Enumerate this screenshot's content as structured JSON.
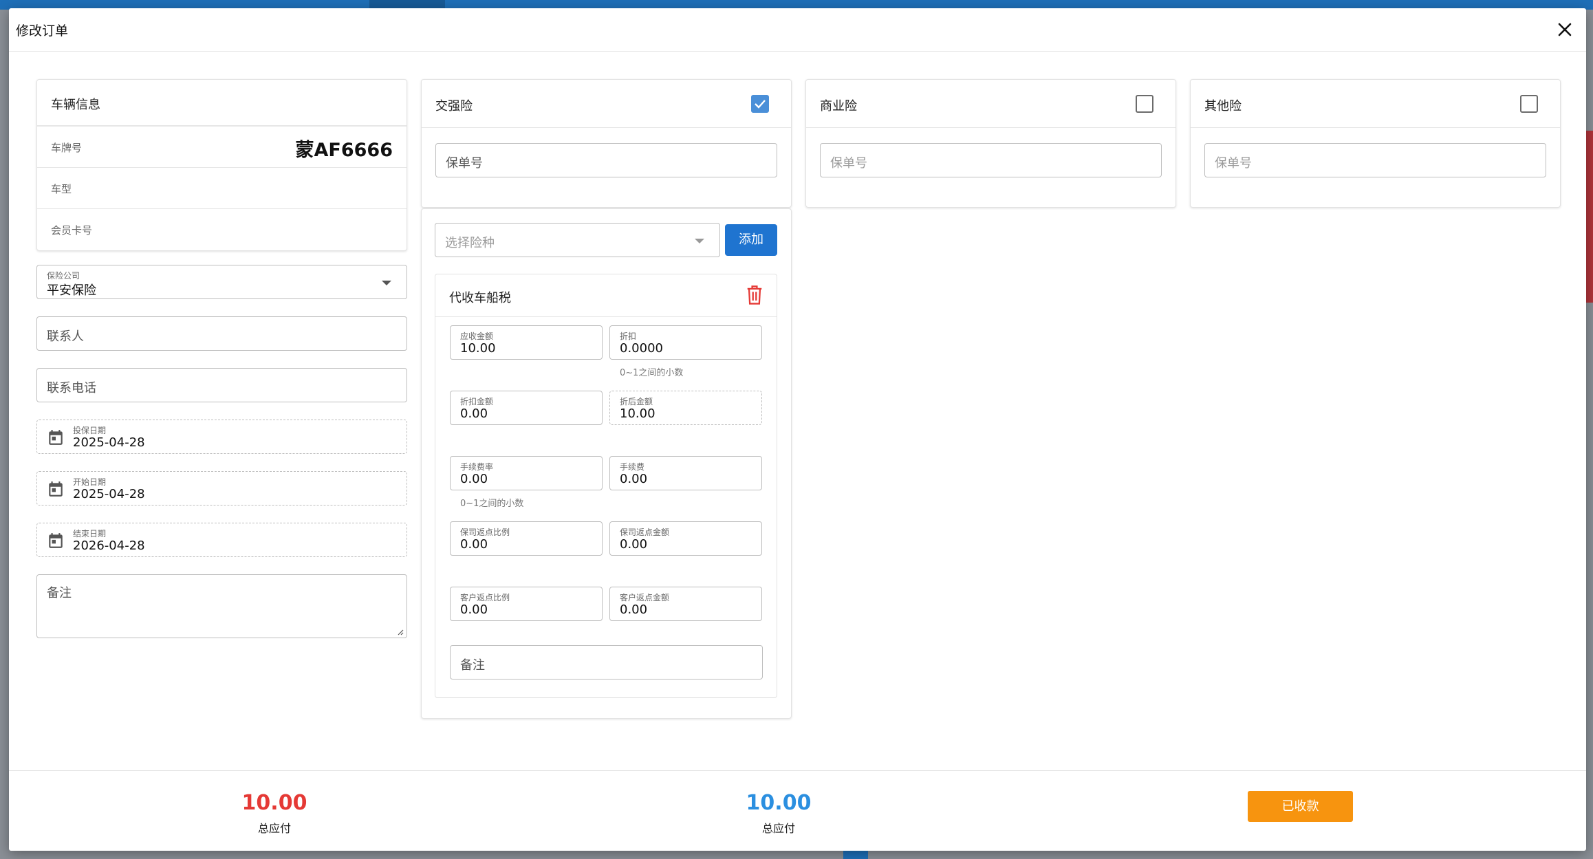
{
  "dialog": {
    "title": "修改订单"
  },
  "vehicle": {
    "header": "车辆信息",
    "plate_label": "车牌号",
    "plate_value": "蒙AF6666",
    "model_label": "车型",
    "member_label": "会员卡号"
  },
  "form": {
    "company_label": "保险公司",
    "company_value": "平安保险",
    "contact_placeholder": "联系人",
    "phone_placeholder": "联系电话",
    "insure_date_label": "投保日期",
    "insure_date_value": "2025-04-28",
    "start_date_label": "开始日期",
    "start_date_value": "2025-04-28",
    "end_date_label": "结束日期",
    "end_date_value": "2026-04-28",
    "remark_placeholder": "备注"
  },
  "compulsory": {
    "header": "交强险",
    "checked": true,
    "policy_placeholder": "保单号",
    "select_placeholder": "选择险种",
    "add_label": "添加",
    "item": {
      "title": "代收车船税",
      "receivable_label": "应收金额",
      "receivable_value": "10.00",
      "discount_label": "折扣",
      "discount_value": "0.0000",
      "discount_hint": "0~1之间的小数",
      "discount_amount_label": "折扣金额",
      "discount_amount_value": "0.00",
      "after_discount_label": "折后金额",
      "after_discount_value": "10.00",
      "fee_rate_label": "手续费率",
      "fee_rate_value": "0.00",
      "fee_rate_hint": "0~1之间的小数",
      "fee_label": "手续费",
      "fee_value": "0.00",
      "company_rebate_ratio_label": "保司返点比例",
      "company_rebate_ratio_value": "0.00",
      "company_rebate_amount_label": "保司返点金额",
      "company_rebate_amount_value": "0.00",
      "customer_rebate_ratio_label": "客户返点比例",
      "customer_rebate_ratio_value": "0.00",
      "customer_rebate_amount_label": "客户返点金额",
      "customer_rebate_amount_value": "0.00",
      "remark_placeholder": "备注"
    }
  },
  "commercial": {
    "header": "商业险",
    "checked": false,
    "policy_placeholder": "保单号"
  },
  "other": {
    "header": "其他险",
    "checked": false,
    "policy_placeholder": "保单号"
  },
  "footer": {
    "total1_value": "10.00",
    "total1_label": "总应付",
    "total2_value": "10.00",
    "total2_label": "总应付",
    "paid_label": "已收款"
  },
  "colors": {
    "primary": "#1f74d0",
    "danger": "#e53935",
    "total_blue": "#2b8fe0",
    "paid_orange": "#f7940f"
  },
  "icons": [
    "close-icon",
    "calendar-icon",
    "chevron-down-icon",
    "checkbox-checked-icon",
    "trash-icon"
  ]
}
